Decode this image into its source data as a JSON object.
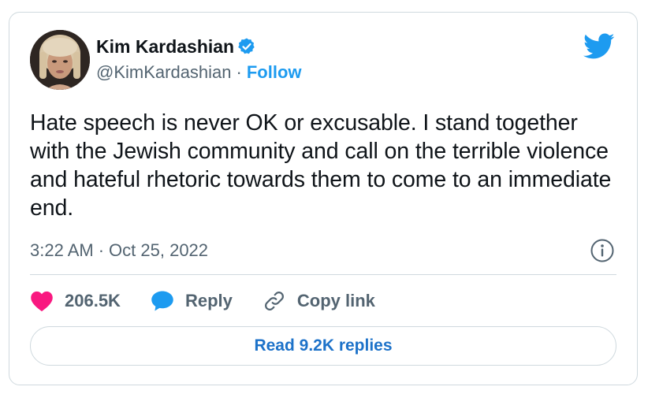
{
  "author": {
    "name": "Kim Kardashian",
    "handle": "@KimKardashian",
    "follow_label": "Follow",
    "separator": "·"
  },
  "tweet": {
    "text": "Hate speech is never OK or excusable. I stand together with the Jewish community and call on the terrible violence and hateful rhetoric towards them to come to an immediate end.",
    "time": "3:22 AM",
    "date": "Oct 25, 2022",
    "separator": "·"
  },
  "actions": {
    "like_count": "206.5K",
    "reply_label": "Reply",
    "copy_link_label": "Copy link"
  },
  "replies_button": {
    "label": "Read 9.2K replies"
  },
  "colors": {
    "accent": "#1d9bf0",
    "like": "#f91880",
    "muted": "#536471",
    "border": "#cfd9de"
  },
  "icons": {
    "verified": "verified-badge-icon",
    "platform": "twitter-bird-icon",
    "info": "info-icon",
    "like": "heart-icon",
    "reply": "speech-bubble-icon",
    "copy_link": "link-icon"
  }
}
